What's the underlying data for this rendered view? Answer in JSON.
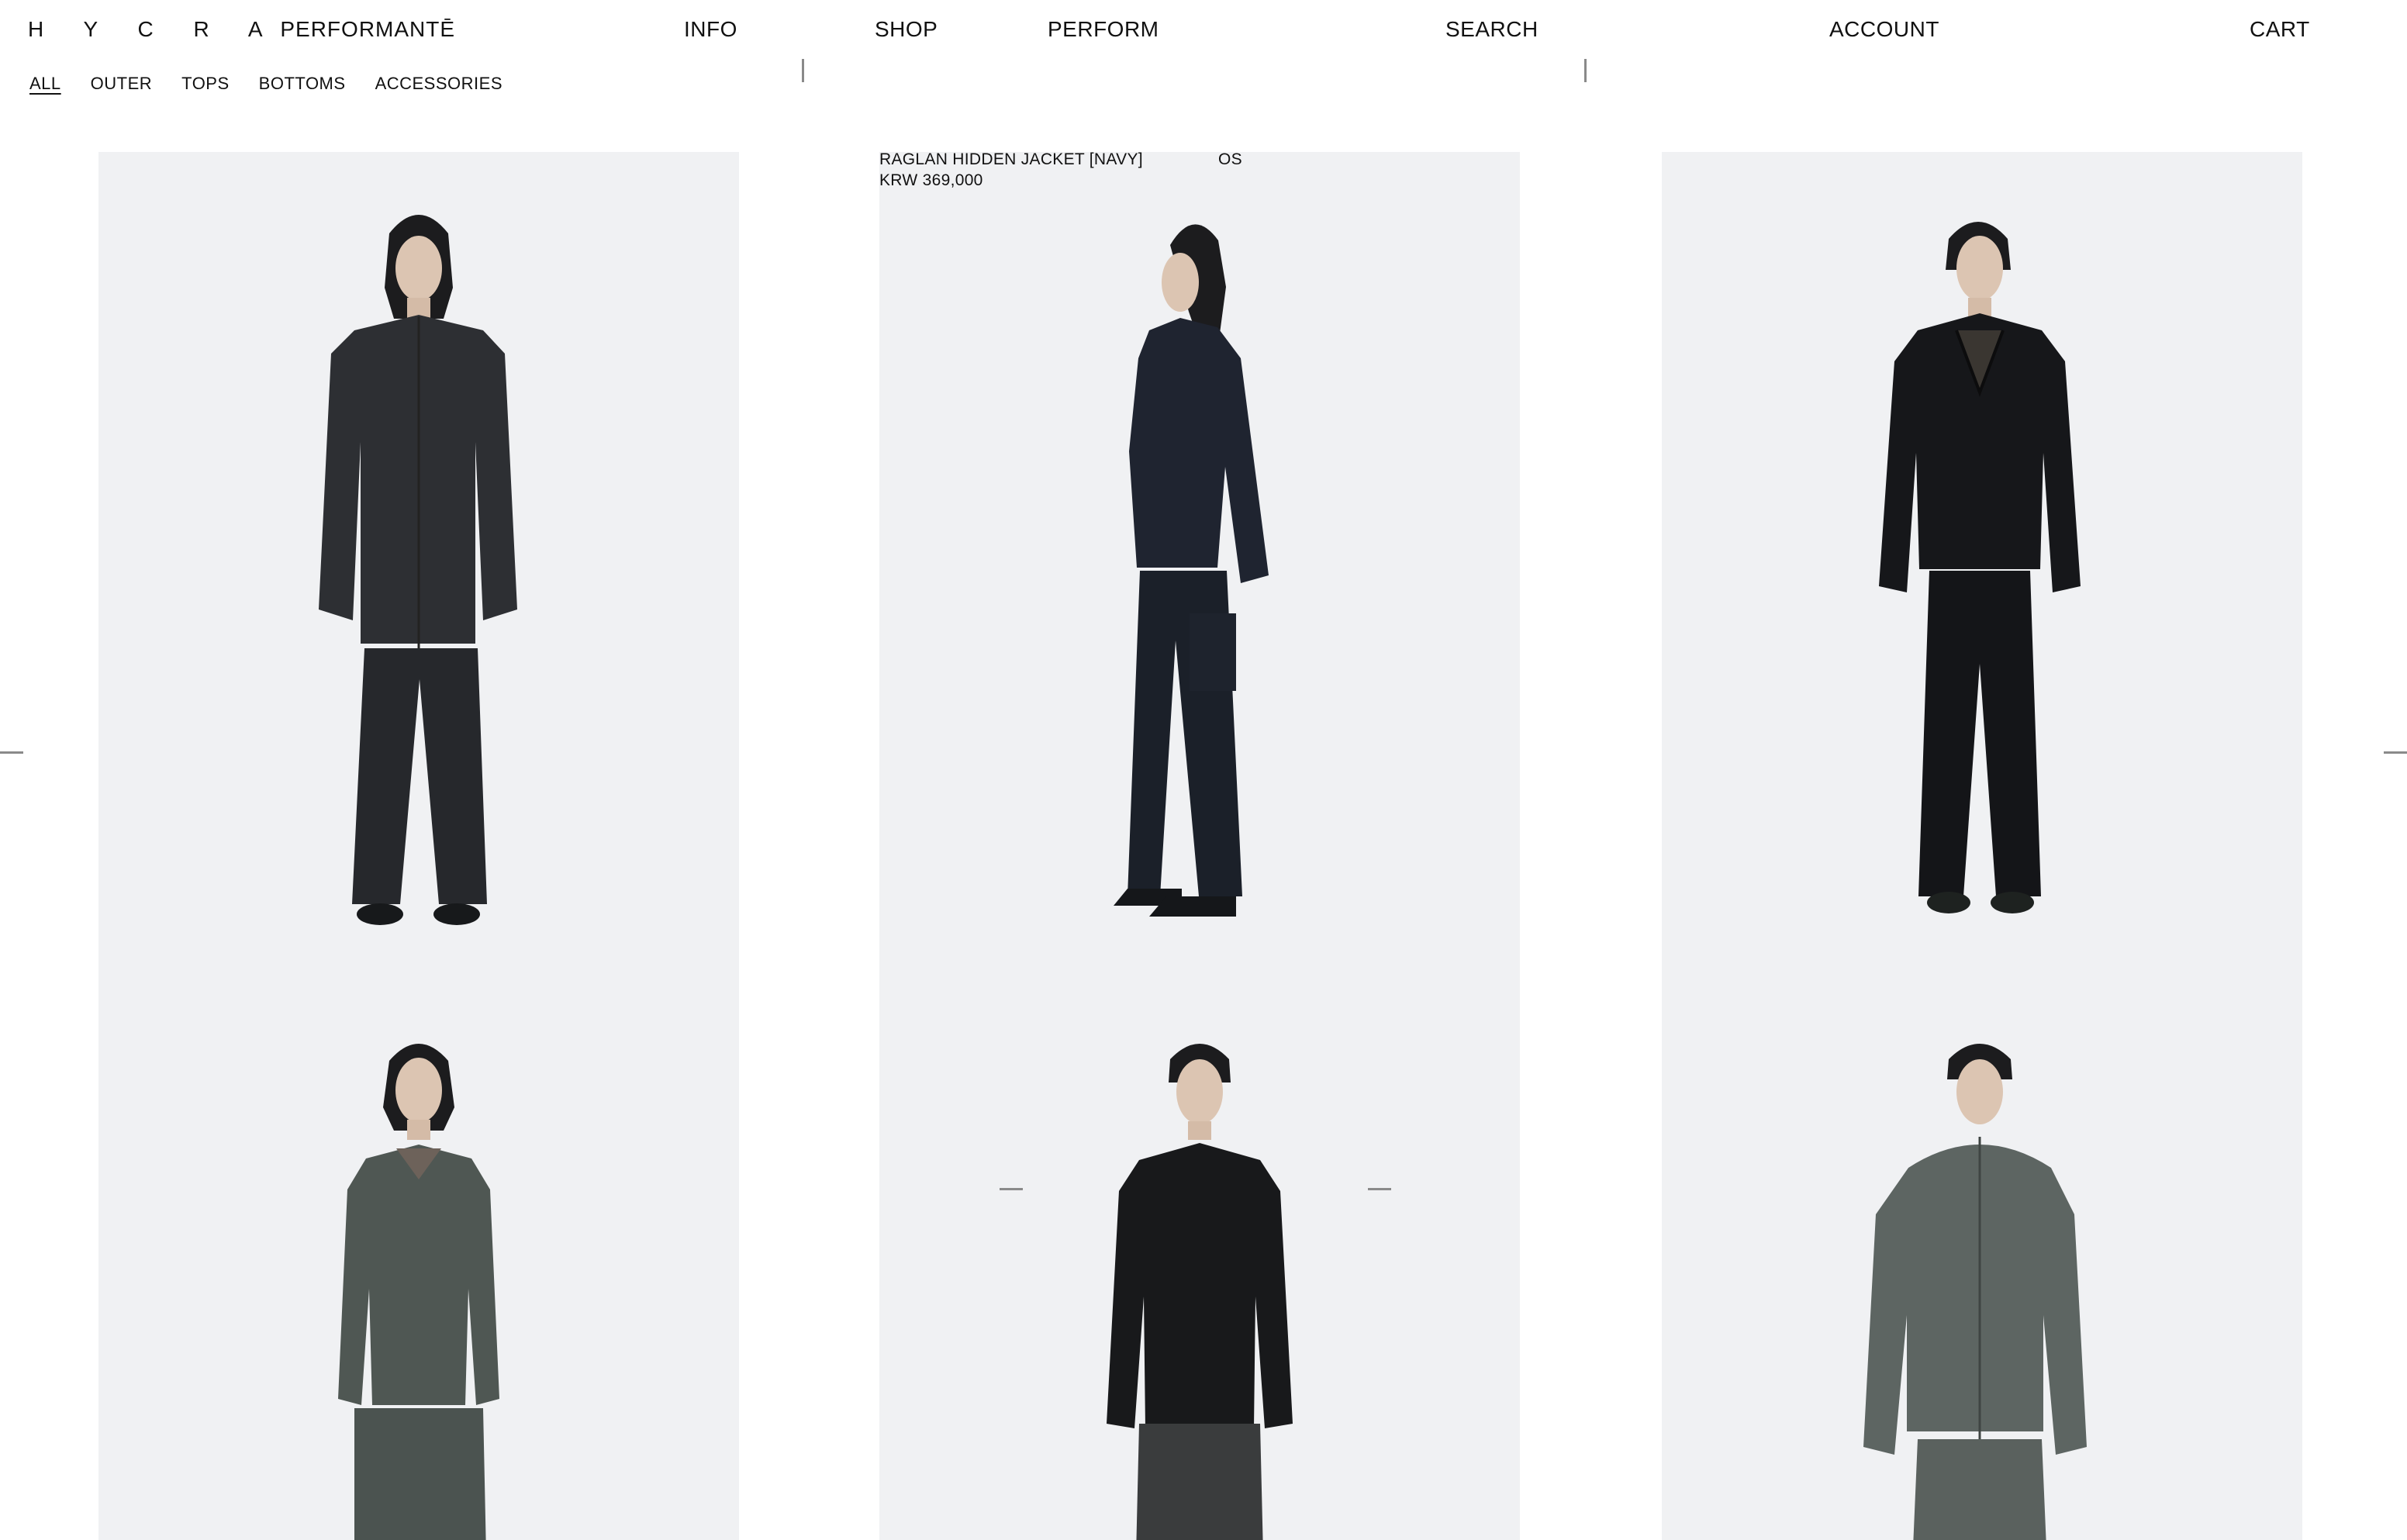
{
  "header": {
    "logo_spaced": "H Y C R A",
    "logo_rest": "PERFORMANTĒ",
    "nav": {
      "info": "INFO",
      "shop": "SHOP",
      "perform": "PERFORM",
      "search": "SEARCH",
      "account": "ACCOUNT",
      "cart": "CART"
    }
  },
  "filters": [
    "ALL",
    "OUTER",
    "TOPS",
    "BOTTOMS",
    "ACCESSORIES"
  ],
  "active_filter": "ALL",
  "hover_product": {
    "name": "RAGLAN HIDDEN JACKET [NAVY]",
    "size": "OS",
    "price": "KRW 369,000"
  },
  "colors": {
    "card_background": "#f0f1f3",
    "text": "#111111",
    "divider": "#8a8a8a"
  }
}
